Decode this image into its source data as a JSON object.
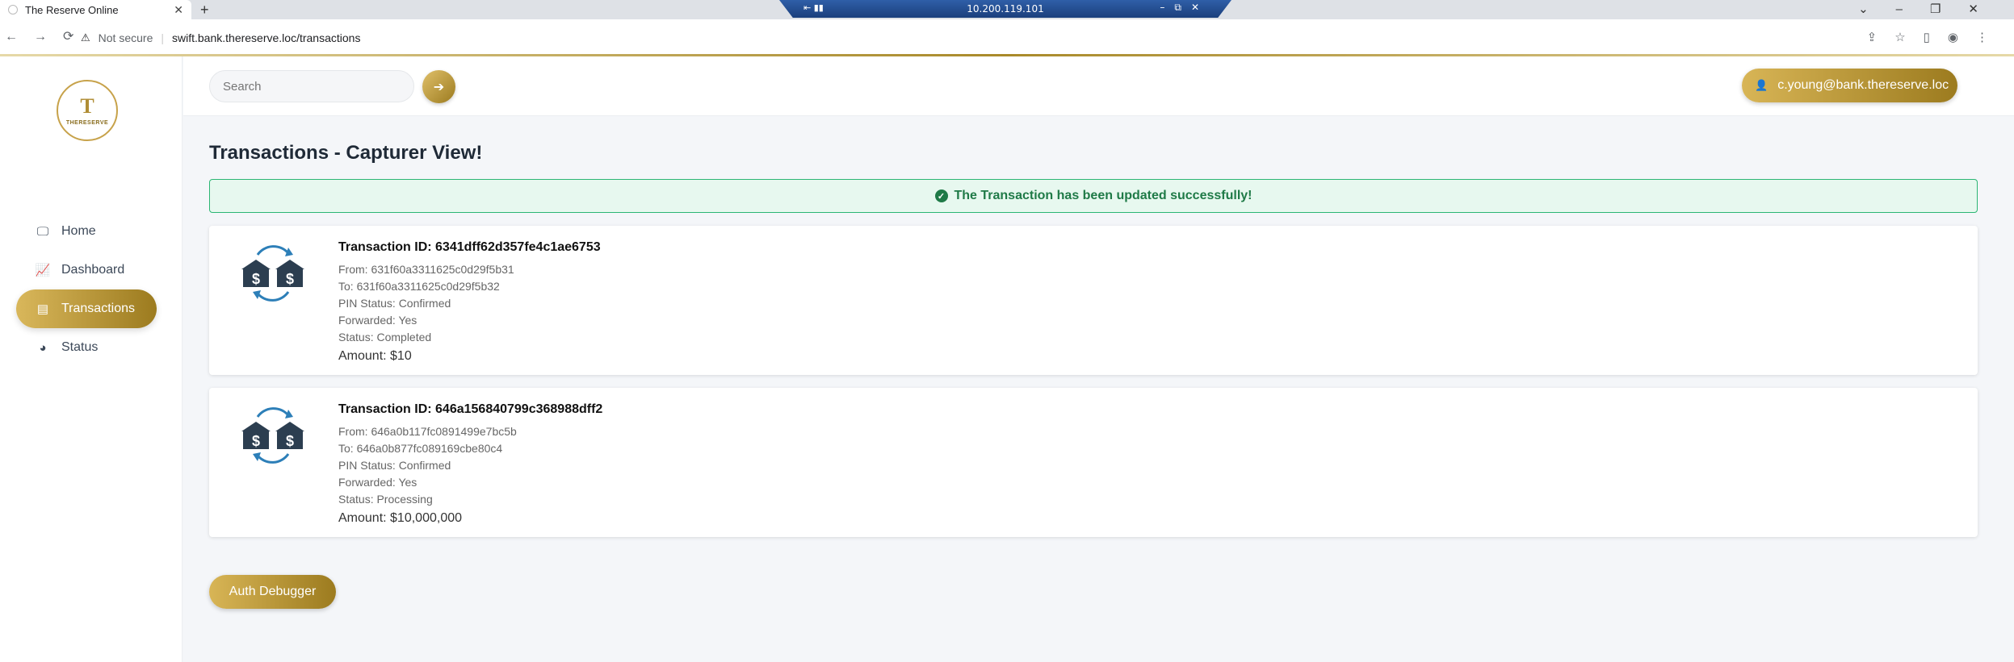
{
  "browser": {
    "tab_title": "The Reserve Online",
    "rdp_address": "10.200.119.101",
    "not_secure": "Not secure",
    "url": "swift.bank.thereserve.loc/transactions"
  },
  "logo": {
    "letter": "T",
    "text": "THERESERVE"
  },
  "sidebar": {
    "items": [
      {
        "label": "Home",
        "icon": "monitor-icon"
      },
      {
        "label": "Dashboard",
        "icon": "chart-line-icon"
      },
      {
        "label": "Transactions",
        "icon": "layers-icon"
      },
      {
        "label": "Status",
        "icon": "pie-chart-icon"
      }
    ],
    "active": "Transactions"
  },
  "header": {
    "search_placeholder": "Search",
    "user_email": "c.young@bank.thereserve.loc"
  },
  "main": {
    "title": "Transactions - Capturer View!",
    "alert": "The Transaction has been updated successfully!",
    "transactions": [
      {
        "id": "Transaction ID: 6341dff62d357fe4c1ae6753",
        "from": "From: 631f60a3311625c0d29f5b31",
        "to": "To: 631f60a3311625c0d29f5b32",
        "pin_status": "PIN Status: Confirmed",
        "forwarded": "Forwarded: Yes",
        "status": "Status: Completed",
        "amount": "Amount: $10"
      },
      {
        "id": "Transaction ID: 646a156840799c368988dff2",
        "from": "From: 646a0b117fc0891499e7bc5b",
        "to": "To: 646a0b877fc089169cbe80c4",
        "pin_status": "PIN Status: Confirmed",
        "forwarded": "Forwarded: Yes",
        "status": "Status: Processing",
        "amount": "Amount: $10,000,000"
      }
    ],
    "auth_button": "Auth Debugger"
  },
  "colors": {
    "gold_accent": "#b08d35",
    "success_green": "#1f7a47",
    "icon_navy": "#2c3e50",
    "icon_blue": "#2d7fb8"
  }
}
